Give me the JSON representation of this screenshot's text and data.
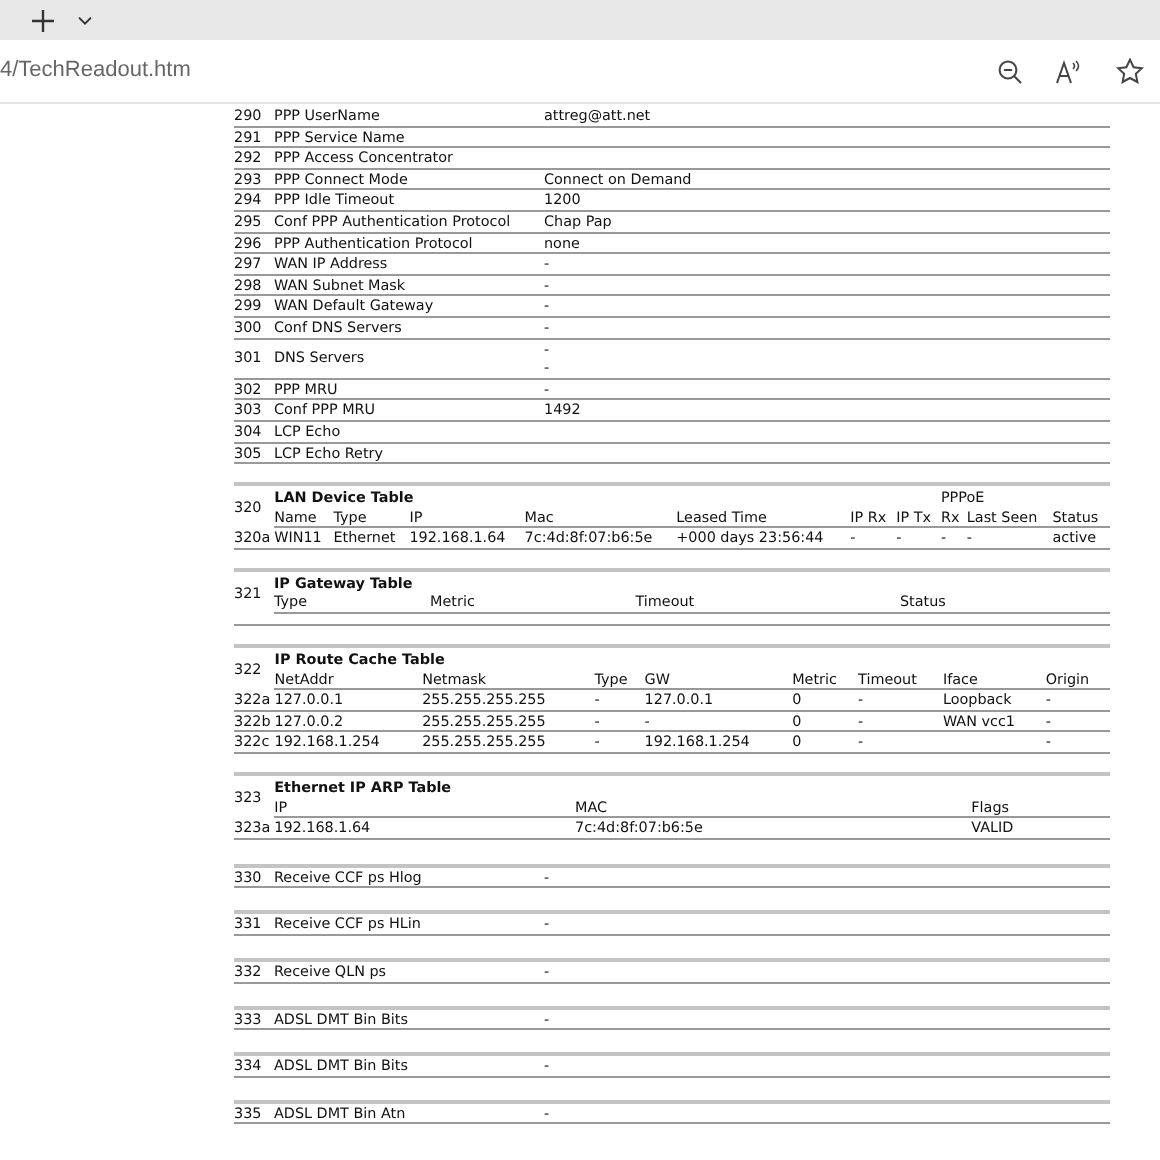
{
  "browser": {
    "url": "4/TechReadout.htm"
  },
  "sections": [
    {
      "kind": "params",
      "rows": [
        {
          "id": "290",
          "name": "PPP UserName",
          "values": [
            "attreg@att.net"
          ]
        },
        {
          "id": "291",
          "name": "PPP Service Name"
        },
        {
          "id": "292",
          "name": "PPP Access Concentrator"
        },
        {
          "id": "293",
          "name": "PPP Connect Mode",
          "values": [
            "Connect on Demand"
          ]
        },
        {
          "id": "294",
          "name": "PPP Idle Timeout",
          "values": [
            "1200"
          ]
        },
        {
          "id": "295",
          "name": "Conf PPP Authentication Protocol",
          "values": [
            "Chap Pap"
          ]
        },
        {
          "id": "296",
          "name": "PPP Authentication Protocol",
          "values": [
            "none"
          ]
        },
        {
          "id": "297",
          "name": "WAN IP Address",
          "values": [
            "-"
          ]
        },
        {
          "id": "298",
          "name": "WAN Subnet Mask",
          "values": [
            "-"
          ]
        },
        {
          "id": "299",
          "name": "WAN Default Gateway",
          "values": [
            "-"
          ]
        },
        {
          "id": "300",
          "name": "Conf DNS Servers",
          "values": [
            "-"
          ]
        },
        {
          "id": "301",
          "name": "DNS Servers",
          "values": [
            "-",
            "-"
          ]
        },
        {
          "id": "302",
          "name": "PPP MRU",
          "values": [
            "-"
          ]
        },
        {
          "id": "303",
          "name": "Conf PPP MRU",
          "values": [
            "1492"
          ]
        },
        {
          "id": "304",
          "name": "LCP Echo"
        },
        {
          "id": "305",
          "name": "LCP Echo Retry"
        }
      ]
    },
    {
      "kind": "table",
      "id": "320",
      "title": "LAN Device Table",
      "group_header": "PPPoE",
      "columns": [
        "Name",
        "Type",
        "IP",
        "Mac",
        "Leased Time",
        "IP Rx",
        "IP Tx",
        "Rx",
        "Last Seen",
        "Status"
      ],
      "rows": [
        {
          "id": "320a",
          "cells": [
            "WIN11",
            "Ethernet",
            "192.168.1.64",
            "7c:4d:8f:07:b6:5e",
            "+000 days 23:56:44",
            "-",
            "-",
            "-",
            "-",
            "active"
          ]
        }
      ]
    },
    {
      "kind": "table",
      "id": "321",
      "title": "IP Gateway Table",
      "columns": [
        "Type",
        "Metric",
        "Timeout",
        "Status"
      ]
    },
    {
      "kind": "table",
      "id": "322",
      "title": "IP Route Cache Table",
      "columns": [
        "NetAddr",
        "Netmask",
        "Type",
        "GW",
        "Metric",
        "Timeout",
        "Iface",
        "Origin"
      ],
      "rows": [
        {
          "id": "322a",
          "cells": [
            "127.0.0.1",
            "255.255.255.255",
            "-",
            "127.0.0.1",
            "0",
            "-",
            "Loopback",
            "-"
          ]
        },
        {
          "id": "322b",
          "cells": [
            "127.0.0.2",
            "255.255.255.255",
            "-",
            "-",
            "0",
            "-",
            "WAN vcc1",
            "-"
          ]
        },
        {
          "id": "322c",
          "cells": [
            "192.168.1.254",
            "255.255.255.255",
            "-",
            "192.168.1.254",
            "0",
            "-",
            null,
            "-"
          ]
        }
      ]
    },
    {
      "kind": "table",
      "id": "323",
      "title": "Ethernet IP ARP Table",
      "columns": [
        "IP",
        "MAC",
        "Flags"
      ],
      "rows": [
        {
          "id": "323a",
          "cells": [
            "192.168.1.64",
            "7c:4d:8f:07:b6:5e",
            "VALID"
          ]
        }
      ]
    },
    {
      "kind": "spaced",
      "rows": [
        {
          "id": "330",
          "name": "Receive CCF ps Hlog",
          "values": [
            "-"
          ]
        },
        {
          "id": "331",
          "name": "Receive CCF ps HLin",
          "values": [
            "-"
          ]
        },
        {
          "id": "332",
          "name": "Receive QLN ps",
          "values": [
            "-"
          ]
        },
        {
          "id": "333",
          "name": "ADSL DMT Bin Bits",
          "values": [
            "-"
          ]
        },
        {
          "id": "334",
          "name": "ADSL DMT Bin Bits",
          "values": [
            "-"
          ]
        },
        {
          "id": "335",
          "name": "ADSL DMT Bin Atn",
          "values": [
            "-"
          ]
        }
      ]
    }
  ]
}
